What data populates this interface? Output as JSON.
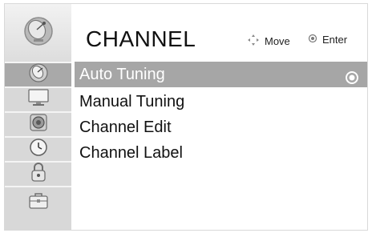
{
  "header": {
    "title": "CHANNEL",
    "hints": [
      {
        "icon": "move-arrows-icon",
        "label": "Move"
      },
      {
        "icon": "enter-circle-icon",
        "label": "Enter"
      }
    ]
  },
  "sidebar": {
    "items": [
      {
        "icon": "satellite-dish-icon",
        "active": true
      },
      {
        "icon": "monitor-icon",
        "active": false
      },
      {
        "icon": "speaker-icon",
        "active": false
      },
      {
        "icon": "clock-icon",
        "active": false
      },
      {
        "icon": "lock-icon",
        "active": false
      },
      {
        "icon": "toolbox-icon",
        "active": false
      }
    ]
  },
  "menu": {
    "items": [
      {
        "label": "Auto Tuning",
        "selected": true
      },
      {
        "label": "Manual Tuning",
        "selected": false
      },
      {
        "label": "Channel Edit",
        "selected": false
      },
      {
        "label": "Channel Label",
        "selected": false
      }
    ]
  },
  "colors": {
    "selected_row": "#a6a6a6",
    "active_sidebar": "#a9a9a9",
    "sidebar": "#d8d8d8"
  }
}
